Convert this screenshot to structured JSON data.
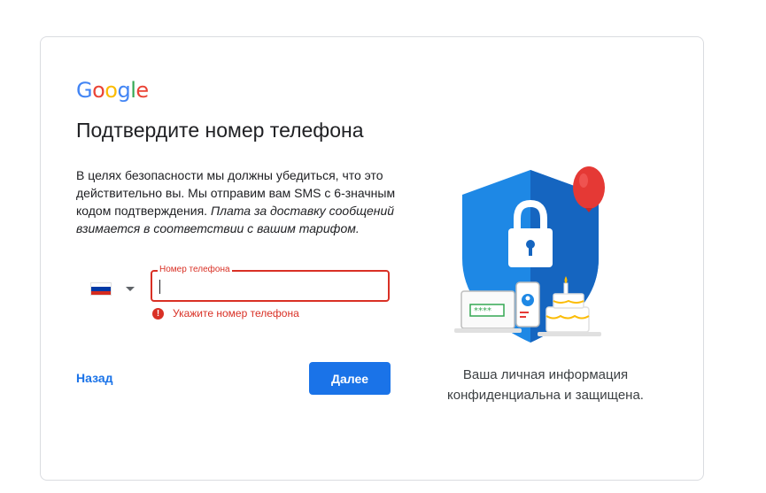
{
  "logo": {
    "letters": [
      {
        "ch": "G",
        "color": "#4285F4"
      },
      {
        "ch": "o",
        "color": "#EA4335"
      },
      {
        "ch": "o",
        "color": "#FBBC05"
      },
      {
        "ch": "g",
        "color": "#4285F4"
      },
      {
        "ch": "l",
        "color": "#34A853"
      },
      {
        "ch": "e",
        "color": "#EA4335"
      }
    ]
  },
  "title": "Подтвердите номер телефона",
  "description": {
    "plain": "В целях безопасности мы должны убедиться, что это действительно вы. Мы отправим вам SMS с 6-значным кодом подтверждения.",
    "italic": "Плата за доставку сообщений взимается в соответствии с вашим тарифом."
  },
  "country": {
    "flag": "russia-flag",
    "flag_colors": [
      "#ffffff",
      "#0039A6",
      "#D52B1E"
    ]
  },
  "phone": {
    "label": "Номер телефона",
    "value": "",
    "error": "Укажите номер телефона"
  },
  "buttons": {
    "back": "Назад",
    "next": "Далее"
  },
  "illustration": {
    "badge_text": "****"
  },
  "caption": "Ваша личная информация конфиденциальна и защищена.",
  "colors": {
    "accent": "#1a73e8",
    "error": "#d93025"
  }
}
